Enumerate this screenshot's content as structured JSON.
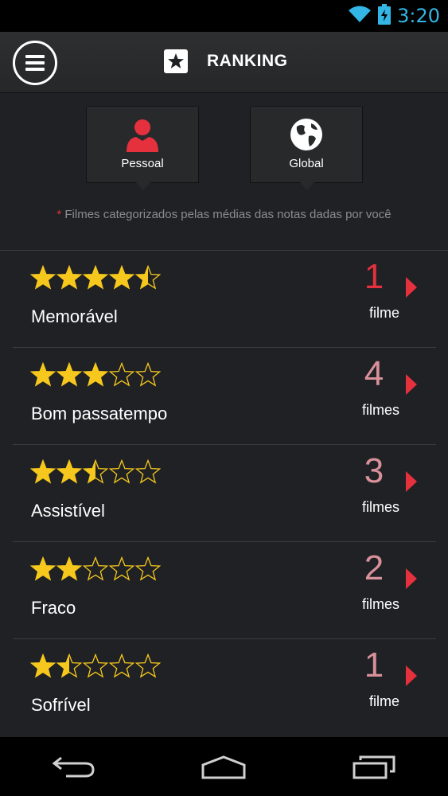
{
  "status": {
    "time": "3:20"
  },
  "header": {
    "title": "RANKING"
  },
  "tabs": [
    {
      "label": "Pessoal",
      "icon": "person-icon",
      "color": "#e5313d"
    },
    {
      "label": "Global",
      "icon": "globe-icon",
      "color": "#ffffff"
    }
  ],
  "note": {
    "asterisk": "*",
    "text": "Filmes categorizados pelas médias das notas dadas por você"
  },
  "rankings": [
    {
      "title": "Memorável",
      "rating": 4.5,
      "count": "1",
      "unit": "filme",
      "count_color": "#e5313d"
    },
    {
      "title": "Bom passatempo",
      "rating": 3,
      "count": "4",
      "unit": "filmes",
      "count_color": "#d8909a"
    },
    {
      "title": "Assistível",
      "rating": 2.5,
      "count": "3",
      "unit": "filmes",
      "count_color": "#d8909a"
    },
    {
      "title": "Fraco",
      "rating": 2,
      "count": "2",
      "unit": "filmes",
      "count_color": "#d8909a"
    },
    {
      "title": "Sofrível",
      "rating": 1.5,
      "count": "1",
      "unit": "filme",
      "count_color": "#d8909a"
    }
  ],
  "colors": {
    "star": "#f6c81d",
    "accent": "#e5313d",
    "status_blue": "#33b5e5"
  }
}
